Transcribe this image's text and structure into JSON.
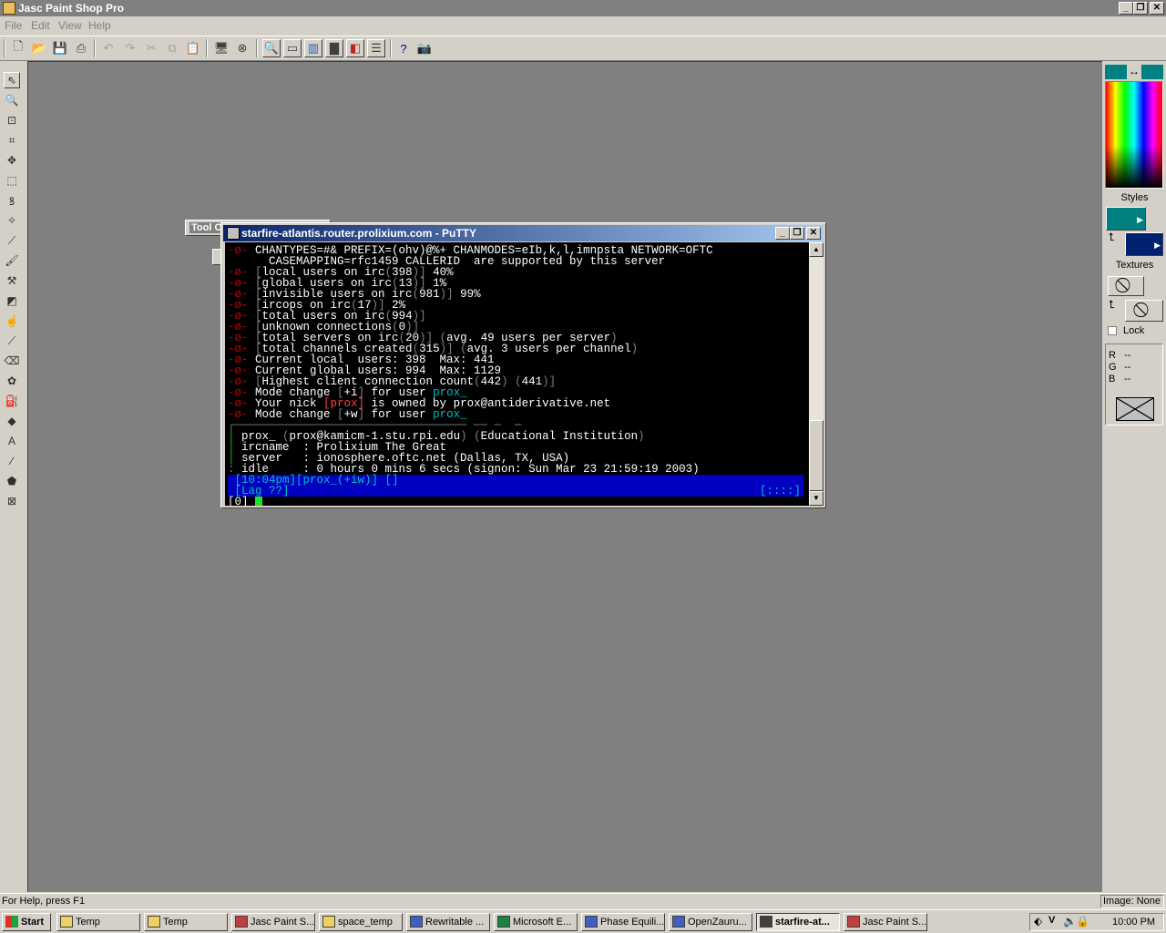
{
  "app": {
    "title": "Jasc Paint Shop Pro",
    "min_glyph": "_",
    "restore_glyph": "❐",
    "close_glyph": "✕"
  },
  "menu": [
    "File",
    "Edit",
    "View",
    "Help"
  ],
  "toolbar_icons": [
    "new-icon",
    "open-icon",
    "save-icon",
    "print-icon",
    "undo-icon",
    "redo-icon",
    "cut-icon",
    "copy-icon",
    "paste-icon",
    "browse-icon",
    "close-all-icon",
    "zoom-icon",
    "overview-icon",
    "histogram-icon",
    "palette-icon",
    "layers-icon",
    "toolbar-icon",
    "help-icon",
    "capture-icon"
  ],
  "tool_options_label": "Tool O",
  "putty": {
    "title": "starfire-atlantis.router.prolixium.com - PuTTY",
    "lines": [
      [
        [
          "bul",
          "-ø- "
        ],
        [
          "w",
          "CHANTYPES=#& PREFIX=(ohv)@%+ CHANMODES=eIb,k,l,imnpsta NETWORK=OFTC"
        ]
      ],
      [
        [
          "w",
          "      CASEMAPPING=rfc1459 CALLERID  are supported by this server"
        ]
      ],
      [
        [
          "bul",
          "-ø- "
        ],
        [
          "g",
          "["
        ],
        [
          "w",
          "local users on irc"
        ],
        [
          "g",
          "("
        ],
        [
          "w",
          "398"
        ],
        [
          "g",
          ")] "
        ],
        [
          "w",
          "40%"
        ]
      ],
      [
        [
          "bul",
          "-ø- "
        ],
        [
          "g",
          "["
        ],
        [
          "w",
          "global users on irc"
        ],
        [
          "g",
          "("
        ],
        [
          "w",
          "13"
        ],
        [
          "g",
          ")] "
        ],
        [
          "w",
          "1%"
        ]
      ],
      [
        [
          "bul",
          "-ø- "
        ],
        [
          "g",
          "["
        ],
        [
          "w",
          "invisible users on irc"
        ],
        [
          "g",
          "("
        ],
        [
          "w",
          "981"
        ],
        [
          "g",
          ")] "
        ],
        [
          "w",
          "99%"
        ]
      ],
      [
        [
          "bul",
          "-ø- "
        ],
        [
          "g",
          "["
        ],
        [
          "w",
          "ircops on irc"
        ],
        [
          "g",
          "("
        ],
        [
          "w",
          "17"
        ],
        [
          "g",
          ")] "
        ],
        [
          "w",
          "2%"
        ]
      ],
      [
        [
          "bul",
          "-ø- "
        ],
        [
          "g",
          "["
        ],
        [
          "w",
          "total users on irc"
        ],
        [
          "g",
          "("
        ],
        [
          "w",
          "994"
        ],
        [
          "g",
          ")]"
        ]
      ],
      [
        [
          "bul",
          "-ø- "
        ],
        [
          "g",
          "["
        ],
        [
          "w",
          "unknown connections"
        ],
        [
          "g",
          "("
        ],
        [
          "w",
          "0"
        ],
        [
          "g",
          ")]"
        ]
      ],
      [
        [
          "bul",
          "-ø- "
        ],
        [
          "g",
          "["
        ],
        [
          "w",
          "total servers on irc"
        ],
        [
          "g",
          "("
        ],
        [
          "w",
          "20"
        ],
        [
          "g",
          ")] ("
        ],
        [
          "w",
          "avg. 49 users per server"
        ],
        [
          "g",
          ")"
        ]
      ],
      [
        [
          "bul",
          "-ø- "
        ],
        [
          "g",
          "["
        ],
        [
          "w",
          "total channels created"
        ],
        [
          "g",
          "("
        ],
        [
          "w",
          "315"
        ],
        [
          "g",
          ")] ("
        ],
        [
          "w",
          "avg. 3 users per channel"
        ],
        [
          "g",
          ")"
        ]
      ],
      [
        [
          "bul",
          "-ø- "
        ],
        [
          "w",
          "Current local  users: 398  Max: 441"
        ]
      ],
      [
        [
          "bul",
          "-ø- "
        ],
        [
          "w",
          "Current global users: 994  Max: 1129"
        ]
      ],
      [
        [
          "bul",
          "-ø- "
        ],
        [
          "g",
          "["
        ],
        [
          "w",
          "Highest client connection count"
        ],
        [
          "g",
          "("
        ],
        [
          "w",
          "442"
        ],
        [
          "g",
          ") ("
        ],
        [
          "w",
          "441"
        ],
        [
          "g",
          ")]"
        ]
      ],
      [
        [
          "bul",
          "-ø- "
        ],
        [
          "w",
          "Mode change "
        ],
        [
          "g",
          "["
        ],
        [
          "w",
          "+i"
        ],
        [
          "g",
          "]"
        ],
        [
          "w",
          " for user "
        ],
        [
          "c",
          "prox_"
        ]
      ],
      [
        [
          "bul",
          "-ø- "
        ],
        [
          "w",
          "Your nick "
        ],
        [
          "r",
          "[prox]"
        ],
        [
          "w",
          " is owned by prox@antiderivative.net"
        ]
      ],
      [
        [
          "bul",
          "-ø- "
        ],
        [
          "w",
          "Mode change "
        ],
        [
          "g",
          "["
        ],
        [
          "w",
          "+w"
        ],
        [
          "g",
          "]"
        ],
        [
          "w",
          " for user "
        ],
        [
          "c",
          "prox_"
        ]
      ],
      [
        [
          "g",
          "┌────────────────────────────────── ── ─  ─"
        ]
      ],
      [
        [
          "gr",
          "│ "
        ],
        [
          "w",
          "prox_ "
        ],
        [
          "g",
          "("
        ],
        [
          "w",
          "prox@kamicm-1.stu.rpi.edu"
        ],
        [
          "g",
          ") ("
        ],
        [
          "w",
          "Educational Institution"
        ],
        [
          "g",
          ")"
        ]
      ],
      [
        [
          "gr",
          "│ "
        ],
        [
          "w",
          "ircname  : Prolixium The Great"
        ]
      ],
      [
        [
          "gr",
          "│ "
        ],
        [
          "w",
          "server   : ionosphere.oftc.net (Dallas, TX, USA)"
        ]
      ],
      [
        [
          "g",
          ": "
        ],
        [
          "w",
          "idle     : 0 hours 0 mins 6 secs (signon: Sun Mar 23 21:59:19 2003)"
        ]
      ]
    ],
    "status1": " [10:04pm][prox_(+iw)] []",
    "status2": " [Lag ??]",
    "status2_right": "[::::]",
    "prompt": "[0] "
  },
  "right_palette": {
    "styles_label": "Styles",
    "textures_label": "Textures",
    "lock_label": "Lock",
    "r_label": "R",
    "g_label": "G",
    "b_label": "B",
    "r_value": "--",
    "g_value": "--",
    "b_value": "--",
    "fg_color": "#008080",
    "bg_color": "#008080"
  },
  "status": {
    "help": "For Help, press F1",
    "image": "Image: None"
  },
  "taskbar": {
    "start": "Start",
    "tasks": [
      "Temp",
      "Temp",
      "Jasc Paint S...",
      "space_temp",
      "Rewritable ...",
      "Microsoft E...",
      "Phase Equili...",
      "OpenZauru...",
      "starfire-at...",
      "Jasc Paint S..."
    ],
    "active_index": 8,
    "clock": "10:00 PM"
  }
}
